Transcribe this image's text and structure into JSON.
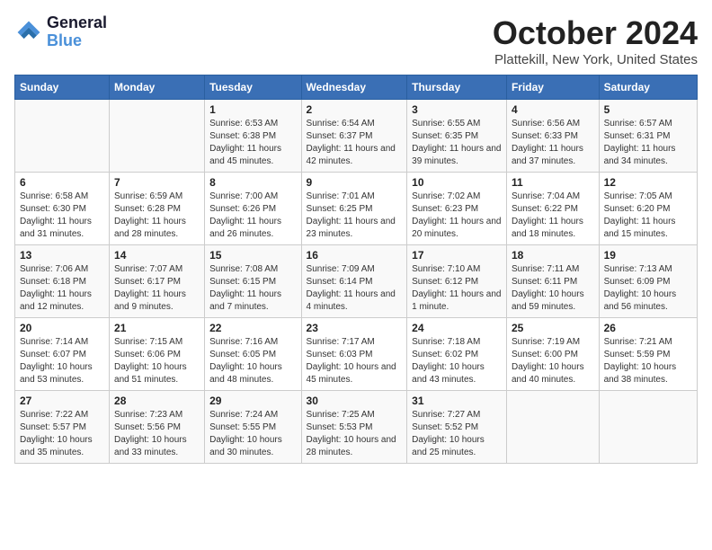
{
  "logo": {
    "line1": "General",
    "line2": "Blue"
  },
  "title": "October 2024",
  "subtitle": "Plattekill, New York, United States",
  "weekdays": [
    "Sunday",
    "Monday",
    "Tuesday",
    "Wednesday",
    "Thursday",
    "Friday",
    "Saturday"
  ],
  "weeks": [
    [
      {
        "day": "",
        "detail": ""
      },
      {
        "day": "",
        "detail": ""
      },
      {
        "day": "1",
        "detail": "Sunrise: 6:53 AM\nSunset: 6:38 PM\nDaylight: 11 hours and 45 minutes."
      },
      {
        "day": "2",
        "detail": "Sunrise: 6:54 AM\nSunset: 6:37 PM\nDaylight: 11 hours and 42 minutes."
      },
      {
        "day": "3",
        "detail": "Sunrise: 6:55 AM\nSunset: 6:35 PM\nDaylight: 11 hours and 39 minutes."
      },
      {
        "day": "4",
        "detail": "Sunrise: 6:56 AM\nSunset: 6:33 PM\nDaylight: 11 hours and 37 minutes."
      },
      {
        "day": "5",
        "detail": "Sunrise: 6:57 AM\nSunset: 6:31 PM\nDaylight: 11 hours and 34 minutes."
      }
    ],
    [
      {
        "day": "6",
        "detail": "Sunrise: 6:58 AM\nSunset: 6:30 PM\nDaylight: 11 hours and 31 minutes."
      },
      {
        "day": "7",
        "detail": "Sunrise: 6:59 AM\nSunset: 6:28 PM\nDaylight: 11 hours and 28 minutes."
      },
      {
        "day": "8",
        "detail": "Sunrise: 7:00 AM\nSunset: 6:26 PM\nDaylight: 11 hours and 26 minutes."
      },
      {
        "day": "9",
        "detail": "Sunrise: 7:01 AM\nSunset: 6:25 PM\nDaylight: 11 hours and 23 minutes."
      },
      {
        "day": "10",
        "detail": "Sunrise: 7:02 AM\nSunset: 6:23 PM\nDaylight: 11 hours and 20 minutes."
      },
      {
        "day": "11",
        "detail": "Sunrise: 7:04 AM\nSunset: 6:22 PM\nDaylight: 11 hours and 18 minutes."
      },
      {
        "day": "12",
        "detail": "Sunrise: 7:05 AM\nSunset: 6:20 PM\nDaylight: 11 hours and 15 minutes."
      }
    ],
    [
      {
        "day": "13",
        "detail": "Sunrise: 7:06 AM\nSunset: 6:18 PM\nDaylight: 11 hours and 12 minutes."
      },
      {
        "day": "14",
        "detail": "Sunrise: 7:07 AM\nSunset: 6:17 PM\nDaylight: 11 hours and 9 minutes."
      },
      {
        "day": "15",
        "detail": "Sunrise: 7:08 AM\nSunset: 6:15 PM\nDaylight: 11 hours and 7 minutes."
      },
      {
        "day": "16",
        "detail": "Sunrise: 7:09 AM\nSunset: 6:14 PM\nDaylight: 11 hours and 4 minutes."
      },
      {
        "day": "17",
        "detail": "Sunrise: 7:10 AM\nSunset: 6:12 PM\nDaylight: 11 hours and 1 minute."
      },
      {
        "day": "18",
        "detail": "Sunrise: 7:11 AM\nSunset: 6:11 PM\nDaylight: 10 hours and 59 minutes."
      },
      {
        "day": "19",
        "detail": "Sunrise: 7:13 AM\nSunset: 6:09 PM\nDaylight: 10 hours and 56 minutes."
      }
    ],
    [
      {
        "day": "20",
        "detail": "Sunrise: 7:14 AM\nSunset: 6:07 PM\nDaylight: 10 hours and 53 minutes."
      },
      {
        "day": "21",
        "detail": "Sunrise: 7:15 AM\nSunset: 6:06 PM\nDaylight: 10 hours and 51 minutes."
      },
      {
        "day": "22",
        "detail": "Sunrise: 7:16 AM\nSunset: 6:05 PM\nDaylight: 10 hours and 48 minutes."
      },
      {
        "day": "23",
        "detail": "Sunrise: 7:17 AM\nSunset: 6:03 PM\nDaylight: 10 hours and 45 minutes."
      },
      {
        "day": "24",
        "detail": "Sunrise: 7:18 AM\nSunset: 6:02 PM\nDaylight: 10 hours and 43 minutes."
      },
      {
        "day": "25",
        "detail": "Sunrise: 7:19 AM\nSunset: 6:00 PM\nDaylight: 10 hours and 40 minutes."
      },
      {
        "day": "26",
        "detail": "Sunrise: 7:21 AM\nSunset: 5:59 PM\nDaylight: 10 hours and 38 minutes."
      }
    ],
    [
      {
        "day": "27",
        "detail": "Sunrise: 7:22 AM\nSunset: 5:57 PM\nDaylight: 10 hours and 35 minutes."
      },
      {
        "day": "28",
        "detail": "Sunrise: 7:23 AM\nSunset: 5:56 PM\nDaylight: 10 hours and 33 minutes."
      },
      {
        "day": "29",
        "detail": "Sunrise: 7:24 AM\nSunset: 5:55 PM\nDaylight: 10 hours and 30 minutes."
      },
      {
        "day": "30",
        "detail": "Sunrise: 7:25 AM\nSunset: 5:53 PM\nDaylight: 10 hours and 28 minutes."
      },
      {
        "day": "31",
        "detail": "Sunrise: 7:27 AM\nSunset: 5:52 PM\nDaylight: 10 hours and 25 minutes."
      },
      {
        "day": "",
        "detail": ""
      },
      {
        "day": "",
        "detail": ""
      }
    ]
  ]
}
